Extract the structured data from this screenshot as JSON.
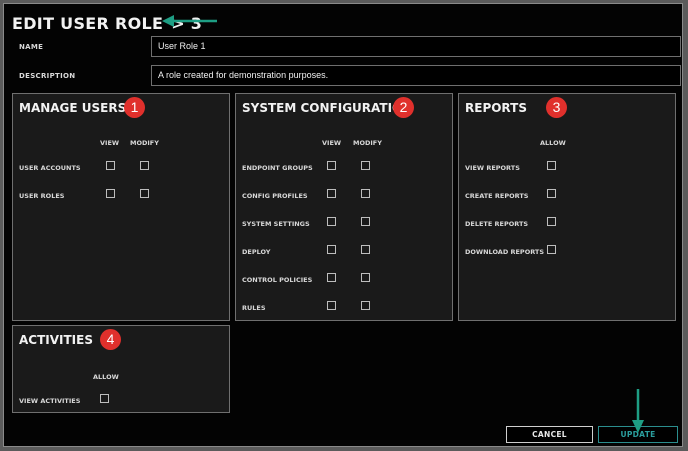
{
  "dialog": {
    "title": "EDIT USER ROLE",
    "step_marker": "> 3",
    "annotation_color": "#1e9e84"
  },
  "form": {
    "name_label": "NAME",
    "name_value": "User Role 1",
    "description_label": "DESCRIPTION",
    "description_value": "A role created for demonstration purposes."
  },
  "panels": {
    "manage_users": {
      "title": "MANAGE USERS",
      "badge": "1",
      "columns": [
        "VIEW",
        "MODIFY"
      ],
      "rows": [
        "USER ACCOUNTS",
        "USER ROLES"
      ]
    },
    "system_configuration": {
      "title": "SYSTEM CONFIGURATION",
      "badge": "2",
      "columns": [
        "VIEW",
        "MODIFY"
      ],
      "rows": [
        "ENDPOINT GROUPS",
        "CONFIG PROFILES",
        "SYSTEM SETTINGS",
        "DEPLOY",
        "CONTROL POLICIES",
        "RULES"
      ]
    },
    "reports": {
      "title": "REPORTS",
      "badge": "3",
      "columns": [
        "ALLOW"
      ],
      "rows": [
        "VIEW REPORTS",
        "CREATE REPORTS",
        "DELETE REPORTS",
        "DOWNLOAD REPORTS"
      ]
    },
    "activities": {
      "title": "ACTIVITIES",
      "badge": "4",
      "columns": [
        "ALLOW"
      ],
      "rows": [
        "VIEW ACTIVITIES"
      ]
    }
  },
  "buttons": {
    "cancel": "CANCEL",
    "update": "UPDATE"
  },
  "colors": {
    "badge": "#e0302c",
    "update_accent": "#2b9e9e"
  }
}
